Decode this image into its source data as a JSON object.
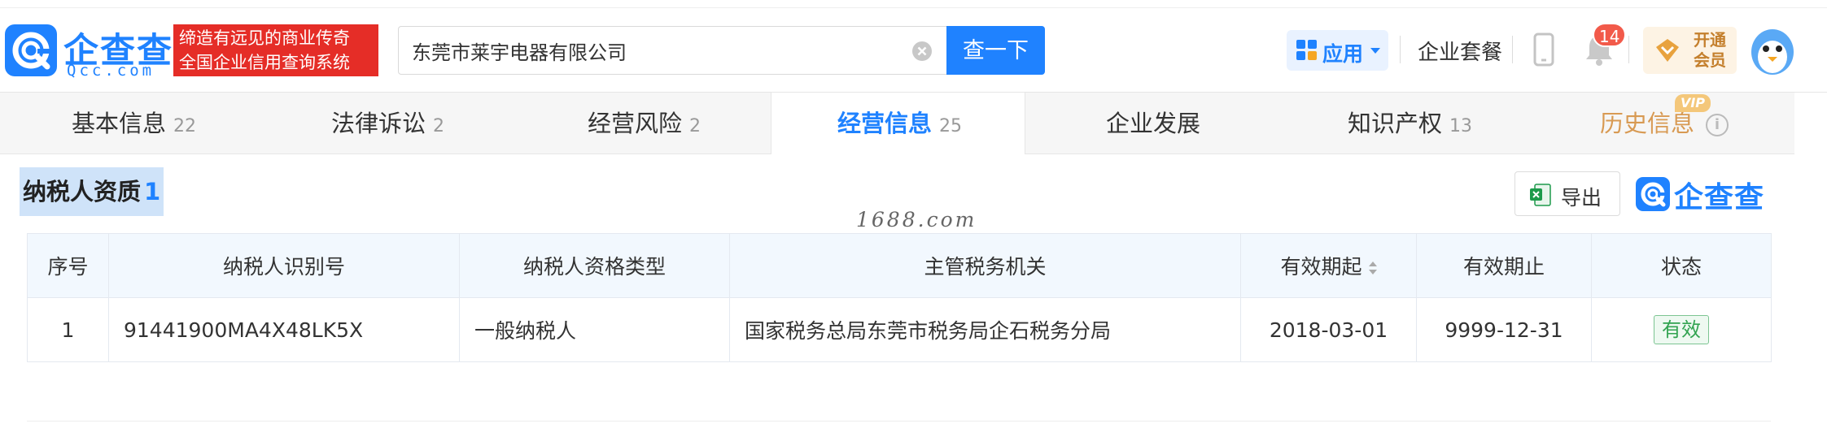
{
  "header": {
    "logo": {
      "name_cn": "企查查",
      "name_en": "Qcc.com",
      "slogan_line1": "缔造有远见的商业传奇",
      "slogan_line2": "全国企业信用查询系统"
    },
    "search": {
      "value": "东莞市莱宇电器有限公司",
      "button_label": "查一下"
    },
    "apps_label": "应用",
    "plan_label": "企业套餐",
    "notification_count": "14",
    "vip_line1": "开通",
    "vip_line2": "会员"
  },
  "tabs": [
    {
      "label": "基本信息",
      "count": "22"
    },
    {
      "label": "法律诉讼",
      "count": "2"
    },
    {
      "label": "经营风险",
      "count": "2"
    },
    {
      "label": "经营信息",
      "count": "25",
      "active": true
    },
    {
      "label": "企业发展",
      "count": ""
    },
    {
      "label": "知识产权",
      "count": "13"
    },
    {
      "label": "历史信息",
      "count": "",
      "vip_tag": "VIP"
    }
  ],
  "section": {
    "title": "纳税人资质",
    "count": "1",
    "export_label": "导出",
    "brand": "企查查",
    "watermark": "1688.com"
  },
  "table": {
    "columns": [
      "序号",
      "纳税人识别号",
      "纳税人资格类型",
      "主管税务机关",
      "有效期起",
      "有效期止",
      "状态"
    ],
    "rows": [
      [
        "1",
        "91441900MA4X48LK5X",
        "一般纳税人",
        "国家税务总局东莞市税务局企石税务分局",
        "2018-03-01",
        "9999-12-31",
        "有效"
      ]
    ]
  },
  "colors": {
    "brand_blue": "#1f82ff",
    "slogan_red": "#e52d27",
    "status_green": "#31a350",
    "history_gold": "#d89a53"
  }
}
